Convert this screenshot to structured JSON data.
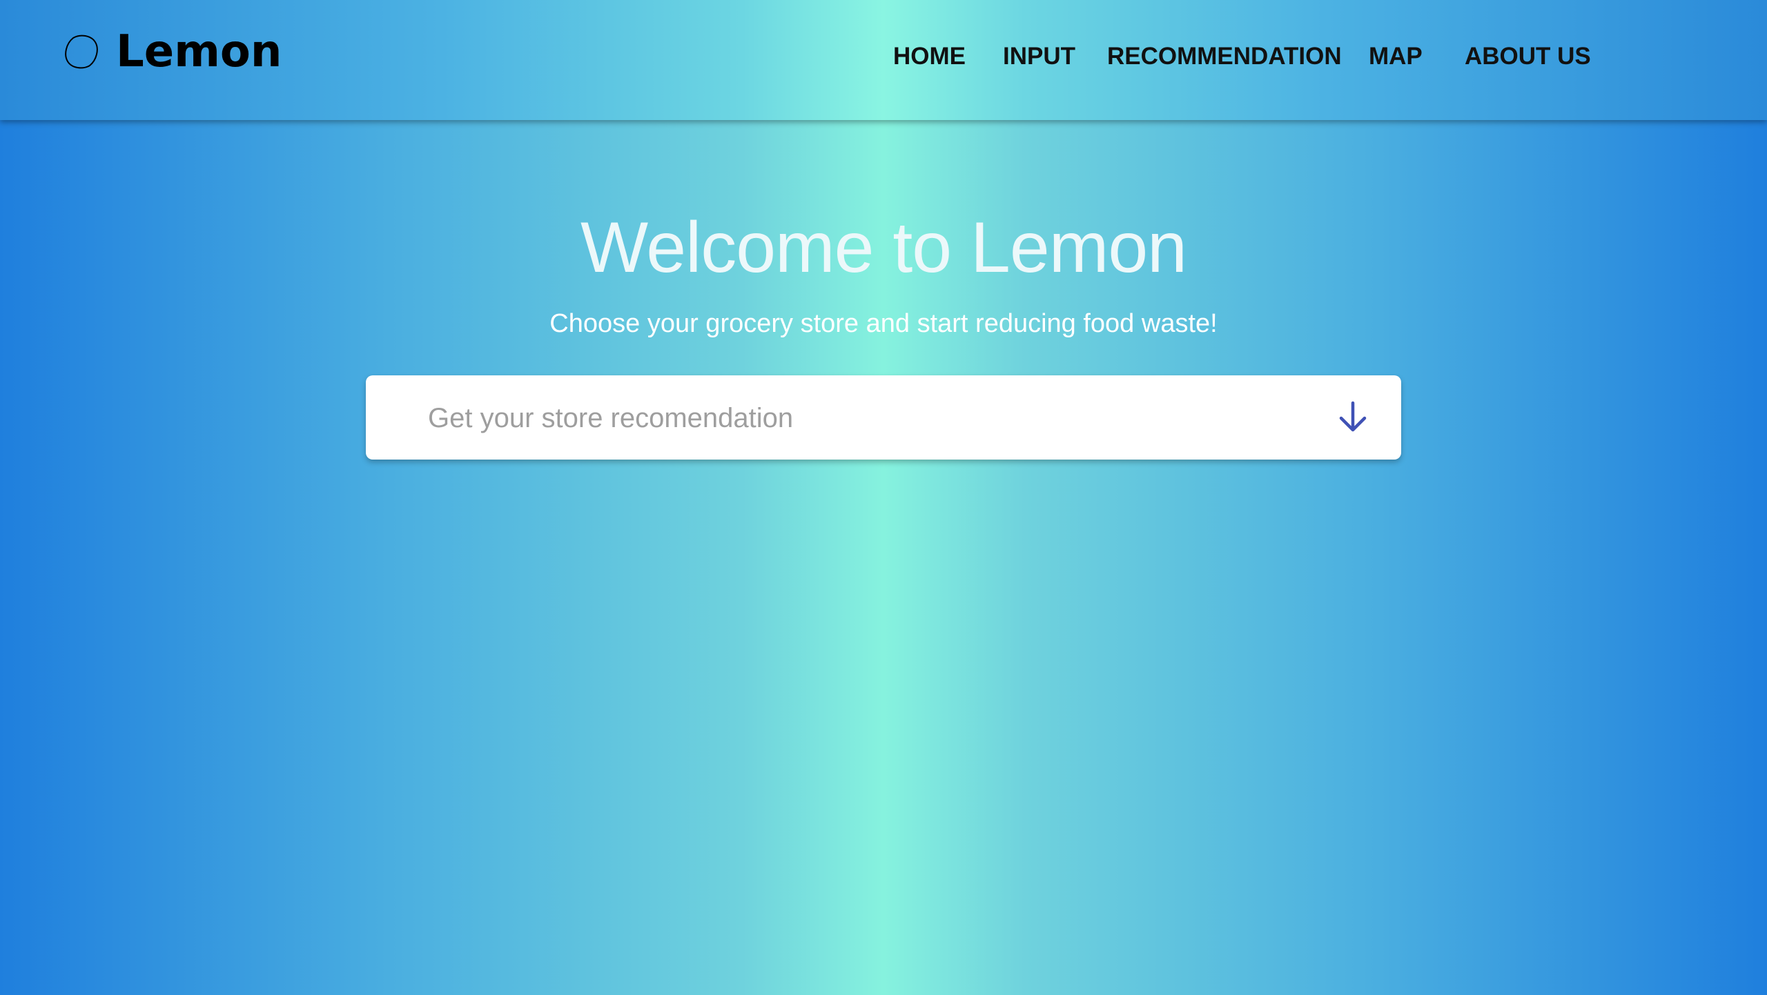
{
  "brand": {
    "name": "Lemon",
    "icon": "lemon-outline-icon"
  },
  "nav": {
    "items": [
      {
        "label": "HOME"
      },
      {
        "label": "INPUT"
      },
      {
        "label": "RECOMMENDATION"
      },
      {
        "label": "MAP"
      },
      {
        "label": "ABOUT US"
      }
    ]
  },
  "hero": {
    "title": "Welcome to Lemon",
    "subtitle": "Choose your grocery store and start reducing food waste!"
  },
  "search": {
    "placeholder": "Get your store recomendation",
    "value": "",
    "dropdown_icon": "arrow-down-icon"
  },
  "colors": {
    "accent": "#3f51b5",
    "gradient_edge": "#1f7fdd",
    "gradient_center": "#86f2de"
  }
}
